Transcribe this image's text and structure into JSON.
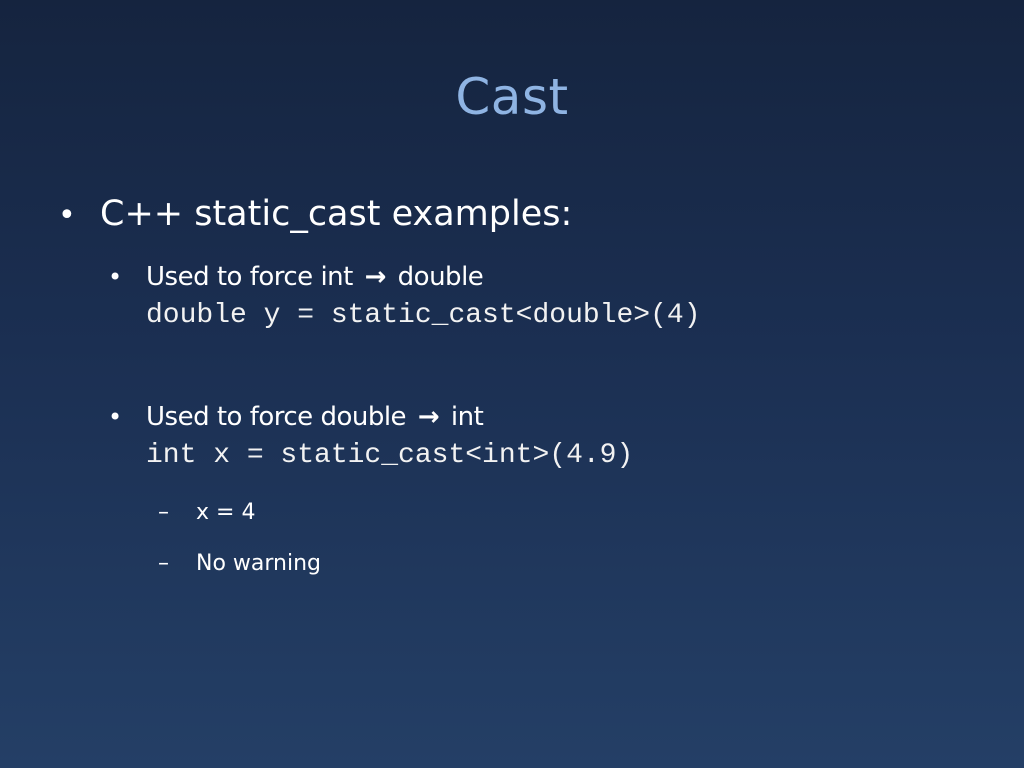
{
  "slide": {
    "title": "Cast",
    "bullets": [
      {
        "marker": "•",
        "text": "C++ static_cast examples:",
        "children": [
          {
            "marker": "•",
            "text_before": "Used to force int",
            "arrow": "→",
            "text_after": "double",
            "code": "double y = static_cast<double>(4)"
          },
          {
            "marker": "•",
            "text_before": "Used to force double",
            "arrow": "→",
            "text_after": "int",
            "code": "int x = static_cast<int>(4.9)",
            "children": [
              {
                "marker": "–",
                "text": "x = 4"
              },
              {
                "marker": "–",
                "text": "No warning"
              }
            ]
          }
        ]
      }
    ]
  },
  "colors": {
    "title": "#8fb4e3",
    "body_text": "#ffffff",
    "background_top": "#15243f",
    "background_bottom": "#243f66"
  }
}
